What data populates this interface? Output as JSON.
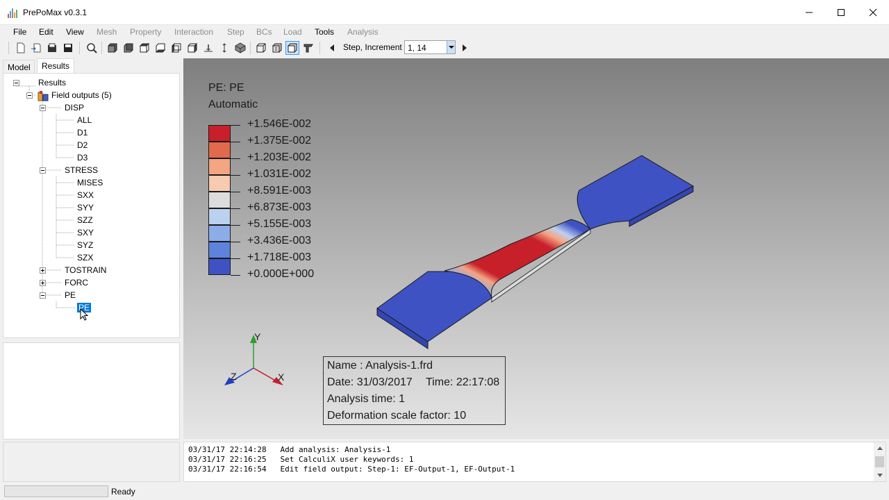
{
  "window": {
    "title": "PrePoMax v0.3.1"
  },
  "menu": {
    "items": [
      "File",
      "Edit",
      "View",
      "Mesh",
      "Property",
      "Interaction",
      "Step",
      "BCs",
      "Load",
      "Tools",
      "Analysis"
    ]
  },
  "toolbar": {
    "step_label": "Step, Increment",
    "step_value": "1, 14"
  },
  "tabs": [
    "Model",
    "Results"
  ],
  "tree": {
    "root": "Results",
    "field_outputs": "Field outputs (5)",
    "groups": [
      {
        "name": "DISP",
        "children": [
          "ALL",
          "D1",
          "D2",
          "D3"
        ]
      },
      {
        "name": "STRESS",
        "children": [
          "MISES",
          "SXX",
          "SYY",
          "SZZ",
          "SXY",
          "SYZ",
          "SZX"
        ]
      },
      {
        "name": "TOSTRAIN",
        "children": []
      },
      {
        "name": "FORC",
        "children": []
      },
      {
        "name": "PE",
        "children": [
          "PE"
        ]
      }
    ],
    "selected": "PE"
  },
  "legend": {
    "title": "PE: PE",
    "mode": "Automatic",
    "values": [
      "+1.546E-002",
      "+1.375E-002",
      "+1.203E-002",
      "+1.031E-002",
      "+8.591E-003",
      "+6.873E-003",
      "+5.155E-003",
      "+3.436E-003",
      "+1.718E-003",
      "+0.000E+000"
    ],
    "colors": [
      "#c8202a",
      "#e06a4c",
      "#f4a582",
      "#f7cbb0",
      "#dcdcdc",
      "#bcd1ef",
      "#8caee8",
      "#5d84da",
      "#3f52c4"
    ]
  },
  "info": {
    "name": "Name : Analysis-1.frd",
    "date": "Date: 31/03/2017",
    "time": "Time: 22:17:08",
    "analysis_time": "Analysis time: 1",
    "scale": "Deformation scale factor: 10"
  },
  "axes": {
    "x": "X",
    "y": "Y",
    "z": "Z"
  },
  "console": {
    "lines": [
      "03/31/17 22:14:28   Add analysis: Analysis-1",
      "03/31/17 22:16:25   Set CalculiX user keywords: 1",
      "03/31/17 22:16:54   Edit field output: Step-1: EF-Output-1, EF-Output-1"
    ]
  },
  "status": {
    "text": "Ready"
  }
}
